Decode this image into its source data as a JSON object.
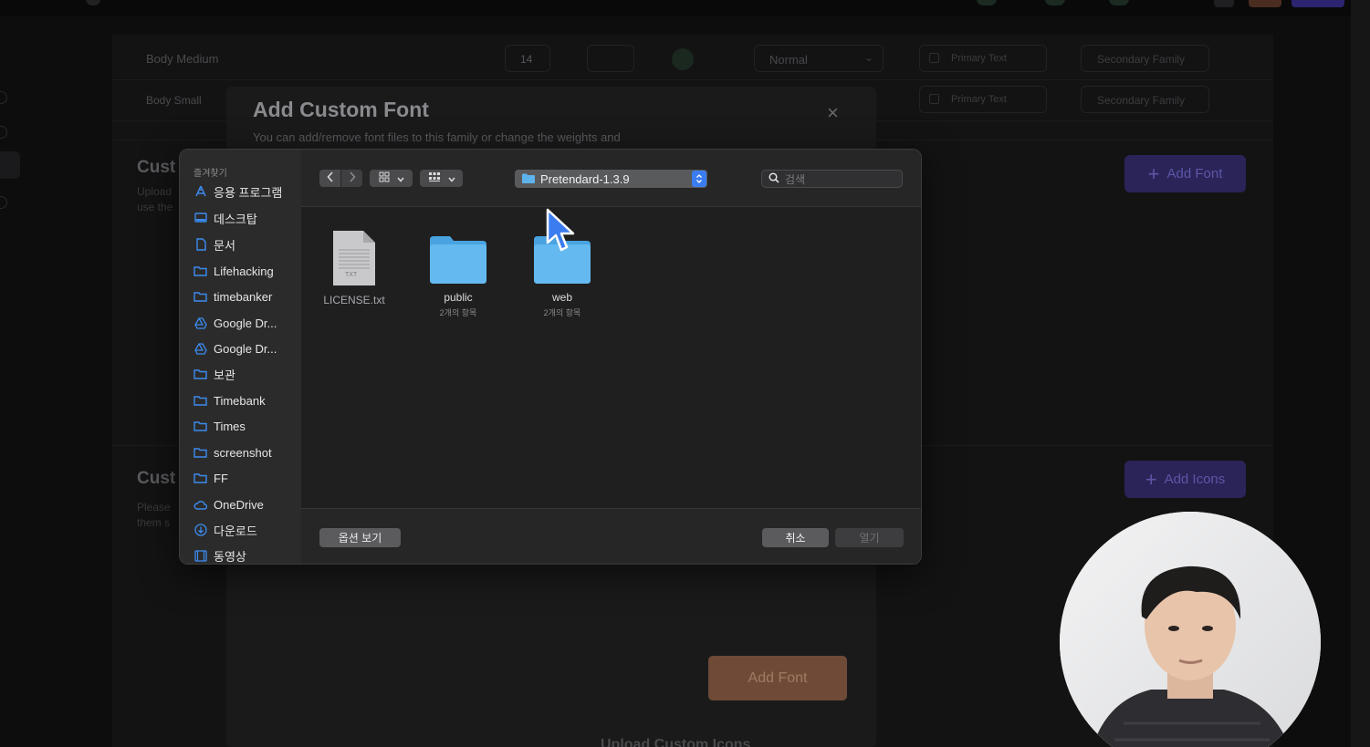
{
  "background": {
    "typography_rows": [
      {
        "name": "Body Medium",
        "size": "14",
        "weight": "Normal",
        "color_label": "Primary Text",
        "family": "Secondary Family"
      },
      {
        "name": "Body Small",
        "color_label": "Primary Text",
        "family": "Secondary Family"
      }
    ],
    "custom_fonts_section": {
      "title_prefix": "Cust",
      "sub_1": "Upload",
      "sub_2": "use the",
      "add_button": "Add Font"
    },
    "custom_icons_section": {
      "title_prefix": "Cust",
      "sub_1": "Please",
      "sub_2": "them s",
      "add_button": "Add Icons"
    }
  },
  "modal": {
    "title": "Add Custom Font",
    "description": "You can add/remove font files to this family or change the weights and",
    "close_glyph": "×",
    "add_font_button": "Add Font",
    "upload_icons_heading": "Upload Custom Icons"
  },
  "file_dialog": {
    "sidebar_heading": "즐겨찾기",
    "sidebar_items": [
      {
        "label": "응용 프로그램",
        "icon": "apps-icon"
      },
      {
        "label": "데스크탑",
        "icon": "desktop-icon"
      },
      {
        "label": "문서",
        "icon": "document-icon"
      },
      {
        "label": "Lifehacking",
        "icon": "folder-icon"
      },
      {
        "label": "timebanker",
        "icon": "folder-icon"
      },
      {
        "label": "Google Dr...",
        "icon": "google-drive-icon"
      },
      {
        "label": "Google Dr...",
        "icon": "google-drive-icon"
      },
      {
        "label": "보관",
        "icon": "folder-icon"
      },
      {
        "label": "Timebank",
        "icon": "folder-icon"
      },
      {
        "label": "Times",
        "icon": "folder-icon"
      },
      {
        "label": "screenshot",
        "icon": "folder-icon"
      },
      {
        "label": "FF",
        "icon": "folder-icon"
      },
      {
        "label": "OneDrive",
        "icon": "cloud-icon"
      },
      {
        "label": "다운로드",
        "icon": "download-icon"
      },
      {
        "label": "동영상",
        "icon": "film-icon"
      }
    ],
    "current_folder": "Pretendard-1.3.9",
    "search_placeholder": "검색",
    "files": [
      {
        "name": "LICENSE.txt",
        "type": "text-file",
        "sub": "",
        "badge": "TXT"
      },
      {
        "name": "public",
        "type": "folder",
        "sub": "2개의 항목"
      },
      {
        "name": "web",
        "type": "folder",
        "sub": "2개의 항목"
      }
    ],
    "options_button": "옵션 보기",
    "cancel_button": "취소",
    "open_button": "열기"
  },
  "colors": {
    "accent_blue": "#3b7df0",
    "folder_blue": "#5fb3ec",
    "modal_button_brown": "#6e4a37",
    "purple_button": "#2a2458"
  }
}
